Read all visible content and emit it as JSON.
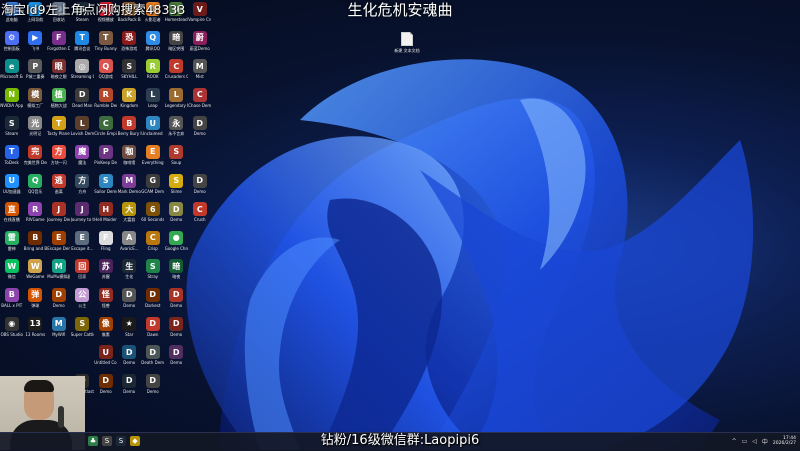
{
  "overlay_text": "淘宝Id9左上角点闪购搜索48333",
  "stream_title": "生化危机安魂曲",
  "wechat_overlay": "钻粉/16级微信群:Laopipi6",
  "desktop_new_file": "新建 文本文档",
  "taskbar": {
    "time": "17:44",
    "date": "2026/2/27",
    "tray_chevron": "^",
    "tray_lang": "中"
  },
  "colors": {
    "wallpaper_bloom": "#1e5cff",
    "wallpaper_bg": "#08122e",
    "taskbar": "#141826"
  },
  "desktop_icons": [
    {
      "label": "此电脑",
      "glyph": "▣",
      "color": "#3a7bd5"
    },
    {
      "label": "上网导航",
      "glyph": "e",
      "color": "#1d8fe1"
    },
    {
      "label": "回收站",
      "glyph": "♲",
      "color": "#6b7a8f"
    },
    {
      "label": "Steam",
      "glyph": "S",
      "color": "#1b2838"
    },
    {
      "label": "视频播放",
      "glyph": "▶",
      "color": "#d23"
    },
    {
      "label": "BackPack Battles",
      "glyph": "B",
      "color": "#8a5a2b"
    },
    {
      "label": "火影忍者",
      "glyph": "火",
      "color": "#e67e22"
    },
    {
      "label": "Homestead Demo",
      "glyph": "H",
      "color": "#4a7d3a"
    },
    {
      "label": "Vampire Create...",
      "glyph": "V",
      "color": "#6d1a1a"
    },
    {
      "label": "控制面板",
      "glyph": "⚙",
      "color": "#4c6ef5"
    },
    {
      "label": "飞书",
      "glyph": "▶",
      "color": "#2f6fed"
    },
    {
      "label": "Forgotten Demo",
      "glyph": "F",
      "color": "#7a2f8c"
    },
    {
      "label": "腾讯会议",
      "glyph": "T",
      "color": "#1e88e5"
    },
    {
      "label": "Tiny Bunny",
      "glyph": "T",
      "color": "#7b5a41"
    },
    {
      "label": "恐怖游戏",
      "glyph": "恐",
      "color": "#8b1a1a"
    },
    {
      "label": "腾讯QQ",
      "glyph": "Q",
      "color": "#2c8ce8"
    },
    {
      "label": "暗区突围",
      "glyph": "暗",
      "color": "#444"
    },
    {
      "label": "蔚蓝Demo",
      "glyph": "蔚",
      "color": "#8b1f5b"
    },
    {
      "label": "Microsoft Edge",
      "glyph": "e",
      "color": "#0c8f8a"
    },
    {
      "label": "P城三重奏",
      "glyph": "P",
      "color": "#5b5b5b"
    },
    {
      "label": "暗夜之眼",
      "glyph": "眼",
      "color": "#7a3030"
    },
    {
      "label": "Streaming Center",
      "glyph": "◎",
      "color": "#aaa"
    },
    {
      "label": "QQ游戏",
      "glyph": "Q",
      "color": "#d9534f"
    },
    {
      "label": "SKYHILL",
      "glyph": "S",
      "color": "#333"
    },
    {
      "label": "ROOK",
      "glyph": "R",
      "color": "#9acd32"
    },
    {
      "label": "Crusaders Quest",
      "glyph": "C",
      "color": "#c0392b"
    },
    {
      "label": "Mist",
      "glyph": "M",
      "color": "#555"
    },
    {
      "label": "NVIDIA App",
      "glyph": "N",
      "color": "#76b900"
    },
    {
      "label": "模拟工厂",
      "glyph": "模",
      "color": "#7a5a3a"
    },
    {
      "label": "植物大战",
      "glyph": "植",
      "color": "#4caf50"
    },
    {
      "label": "Dead Man",
      "glyph": "D",
      "color": "#3b3b3b"
    },
    {
      "label": "Rumble Demo",
      "glyph": "R",
      "color": "#b3472a"
    },
    {
      "label": "Kingdom",
      "glyph": "K",
      "color": "#c9a227"
    },
    {
      "label": "Leap",
      "glyph": "L",
      "color": "#2c3e50"
    },
    {
      "label": "Legendary Demo",
      "glyph": "L",
      "color": "#9c6b30"
    },
    {
      "label": "Chase Demo",
      "glyph": "C",
      "color": "#a33"
    },
    {
      "label": "Steam",
      "glyph": "S",
      "color": "#1b2838"
    },
    {
      "label": "光明记",
      "glyph": "光",
      "color": "#888"
    },
    {
      "label": "Tasty Planet Final Bite",
      "glyph": "T",
      "color": "#d4a017"
    },
    {
      "label": "Lovish Demo",
      "glyph": "L",
      "color": "#5a3d2b"
    },
    {
      "label": "Circle Empires 2",
      "glyph": "C",
      "color": "#3d6b3d"
    },
    {
      "label": "Berry Bury Berry",
      "glyph": "B",
      "color": "#c0392b"
    },
    {
      "label": "Unclaimed Island Pla...",
      "glyph": "U",
      "color": "#2e86c1"
    },
    {
      "label": "永不言弃",
      "glyph": "永",
      "color": "#555"
    },
    {
      "label": "Demo",
      "glyph": "D",
      "color": "#444"
    },
    {
      "label": "ToDesk",
      "glyph": "T",
      "color": "#2563eb"
    },
    {
      "label": "完美世界 Demo",
      "glyph": "完",
      "color": "#c0392b"
    },
    {
      "label": "方块一闪",
      "glyph": "方",
      "color": "#e74c3c"
    },
    {
      "label": "魔法",
      "glyph": "魔",
      "color": "#8e44ad"
    },
    {
      "label": "PinKeep Demo",
      "glyph": "P",
      "color": "#6c3483"
    },
    {
      "label": "咖啡馆",
      "glyph": "咖",
      "color": "#6d4c41"
    },
    {
      "label": "Everything",
      "glyph": "E",
      "color": "#e67e22"
    },
    {
      "label": "Soup",
      "glyph": "S",
      "color": "#b03a2e"
    },
    {
      "label": "",
      "glyph": "",
      "color": "transparent"
    },
    {
      "label": "UU加速器",
      "glyph": "U",
      "color": "#1e90ff"
    },
    {
      "label": "QQ音乐",
      "glyph": "Q",
      "color": "#27ae60"
    },
    {
      "label": "逃离",
      "glyph": "逃",
      "color": "#c0392b"
    },
    {
      "label": "方舟",
      "glyph": "方",
      "color": "#34495e"
    },
    {
      "label": "Sailor Demo",
      "glyph": "S",
      "color": "#2e86c1"
    },
    {
      "label": "Mark Demo",
      "glyph": "M",
      "color": "#7d3c98"
    },
    {
      "label": "GCAM Demo",
      "glyph": "G",
      "color": "#3c3c3c"
    },
    {
      "label": "Slime",
      "glyph": "S",
      "color": "#d4ac0d"
    },
    {
      "label": "Demo",
      "glyph": "D",
      "color": "#444"
    },
    {
      "label": "在线直播",
      "glyph": "直",
      "color": "#d35400"
    },
    {
      "label": "RIVGame",
      "glyph": "R",
      "color": "#8e44ad"
    },
    {
      "label": "Journey Demo",
      "glyph": "J",
      "color": "#a93226"
    },
    {
      "label": "Journey to the Voi...",
      "glyph": "J",
      "color": "#5b2c6f"
    },
    {
      "label": "Hell Maiden Demo",
      "glyph": "H",
      "color": "#922b21"
    },
    {
      "label": "大富翁",
      "glyph": "大",
      "color": "#b7950b"
    },
    {
      "label": "60 Seconds Reatomized",
      "glyph": "6",
      "color": "#7e5109"
    },
    {
      "label": "Demo",
      "glyph": "D",
      "color": "#884"
    },
    {
      "label": "Crush",
      "glyph": "C",
      "color": "#c0392b"
    },
    {
      "label": "雷神",
      "glyph": "雷",
      "color": "#27ae60"
    },
    {
      "label": "Bring and Become...",
      "glyph": "B",
      "color": "#6e2c00"
    },
    {
      "label": "Escape Demo",
      "glyph": "E",
      "color": "#a04000"
    },
    {
      "label": "Escape it...",
      "glyph": "E",
      "color": "#5d6d7e"
    },
    {
      "label": "Fling",
      "glyph": "F",
      "color": "#ddd"
    },
    {
      "label": "AvaricE...",
      "glyph": "A",
      "color": "#888"
    },
    {
      "label": "Crisp",
      "glyph": "C",
      "color": "#b9770e"
    },
    {
      "label": "Google Chrome",
      "glyph": "●",
      "color": "#34a853"
    },
    {
      "label": "",
      "glyph": "",
      "color": "transparent"
    },
    {
      "label": "微信",
      "glyph": "W",
      "color": "#07c160"
    },
    {
      "label": "WeGame",
      "glyph": "W",
      "color": "#cfa349"
    },
    {
      "label": "MuMu模拟器",
      "glyph": "M",
      "color": "#16a085"
    },
    {
      "label": "回家",
      "glyph": "回",
      "color": "#c0392b"
    },
    {
      "label": "苏醒",
      "glyph": "苏",
      "color": "#4a235a"
    },
    {
      "label": "生化",
      "glyph": "生",
      "color": "#1c2833"
    },
    {
      "label": "Stray",
      "glyph": "S",
      "color": "#1e8449"
    },
    {
      "label": "暗夜",
      "glyph": "暗",
      "color": "#145a32"
    },
    {
      "label": "",
      "glyph": "",
      "color": "transparent"
    },
    {
      "label": "BALL x PIT",
      "glyph": "B",
      "color": "#8e44ad"
    },
    {
      "label": "弹球",
      "glyph": "弹",
      "color": "#d35400"
    },
    {
      "label": "Demo",
      "glyph": "D",
      "color": "#a04000"
    },
    {
      "label": "公主",
      "glyph": "公",
      "color": "#c39bd3"
    },
    {
      "label": "怪兽",
      "glyph": "怪",
      "color": "#922b21"
    },
    {
      "label": "Demo",
      "glyph": "D",
      "color": "#555"
    },
    {
      "label": "Darkest",
      "glyph": "D",
      "color": "#6e2c00"
    },
    {
      "label": "Demo",
      "glyph": "D",
      "color": "#a93226"
    },
    {
      "label": "",
      "glyph": "",
      "color": "transparent"
    },
    {
      "label": "OBS Studio",
      "glyph": "◉",
      "color": "#333"
    },
    {
      "label": "13 Rooms",
      "glyph": "13",
      "color": "#1c1c1c"
    },
    {
      "label": "MyWifi",
      "glyph": "M",
      "color": "#2874a6"
    },
    {
      "label": "Super Cattle",
      "glyph": "S",
      "color": "#7d6608"
    },
    {
      "label": "像素",
      "glyph": "像",
      "color": "#a04000"
    },
    {
      "label": "Star",
      "glyph": "★",
      "color": "#1a1a1a"
    },
    {
      "label": "Dawn",
      "glyph": "D",
      "color": "#c0392b"
    },
    {
      "label": "Demo",
      "glyph": "D",
      "color": "#7b241c"
    },
    {
      "label": "",
      "glyph": "",
      "color": "transparent"
    },
    {
      "label": "",
      "glyph": "",
      "color": "transparent"
    },
    {
      "label": "",
      "glyph": "",
      "color": "transparent"
    },
    {
      "label": "",
      "glyph": "",
      "color": "transparent"
    },
    {
      "label": "",
      "glyph": "",
      "color": "transparent"
    },
    {
      "label": "Untitled Company",
      "glyph": "U",
      "color": "#7b241c"
    },
    {
      "label": "Demo",
      "glyph": "D",
      "color": "#1a5276"
    },
    {
      "label": "Death Demo",
      "glyph": "D",
      "color": "#4d5656"
    },
    {
      "label": "Demo",
      "glyph": "D",
      "color": "#512e5f"
    },
    {
      "label": "",
      "glyph": "",
      "color": "transparent"
    },
    {
      "label": "",
      "glyph": "",
      "color": "transparent"
    },
    {
      "label": "",
      "glyph": "",
      "color": "transparent"
    },
    {
      "label": "",
      "glyph": "",
      "color": "transparent"
    },
    {
      "label": "The Outlast Trials",
      "glyph": "O",
      "color": "#2c2c2c"
    },
    {
      "label": "Demo",
      "glyph": "D",
      "color": "#6e2c00"
    },
    {
      "label": "Demo",
      "glyph": "D",
      "color": "#1c2833"
    },
    {
      "label": "Demo",
      "glyph": "D",
      "color": "#444"
    },
    {
      "label": "",
      "glyph": "",
      "color": "transparent"
    },
    {
      "label": "",
      "glyph": "",
      "color": "transparent"
    }
  ]
}
